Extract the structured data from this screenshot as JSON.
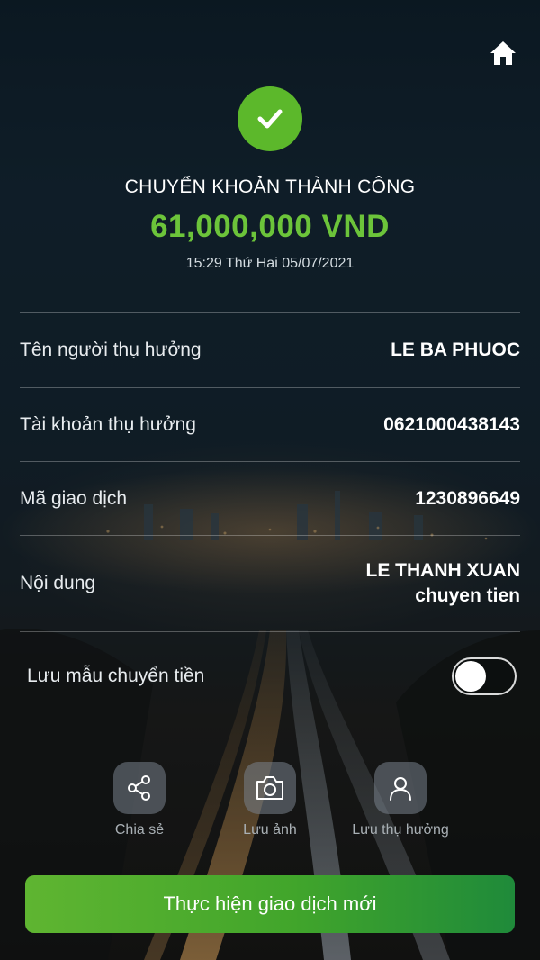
{
  "header": {
    "home_icon": "home-icon"
  },
  "status": {
    "icon": "checkmark-icon",
    "title": "CHUYỂN KHOẢN THÀNH CÔNG",
    "amount": "61,000,000 VND",
    "datetime": "15:29 Thứ Hai 05/07/2021"
  },
  "details": [
    {
      "label": "Tên người thụ hưởng",
      "value": "LE BA PHUOC"
    },
    {
      "label": "Tài khoản thụ hưởng",
      "value": "0621000438143"
    },
    {
      "label": "Mã giao dịch",
      "value": "1230896649"
    },
    {
      "label": "Nội dung",
      "value_line1": "LE THANH XUAN",
      "value_line2": "chuyen tien"
    }
  ],
  "save_template": {
    "label": "Lưu mẫu chuyển tiền",
    "enabled": false
  },
  "actions": [
    {
      "label": "Chia sẻ",
      "icon": "share-icon"
    },
    {
      "label": "Lưu ảnh",
      "icon": "camera-icon"
    },
    {
      "label": "Lưu thụ hưởng",
      "icon": "person-icon"
    }
  ],
  "primary_button": {
    "label": "Thực hiện giao dịch mới"
  },
  "colors": {
    "accent_green": "#6cc43a",
    "check_green": "#5cb82b",
    "background_dark": "#142633"
  }
}
